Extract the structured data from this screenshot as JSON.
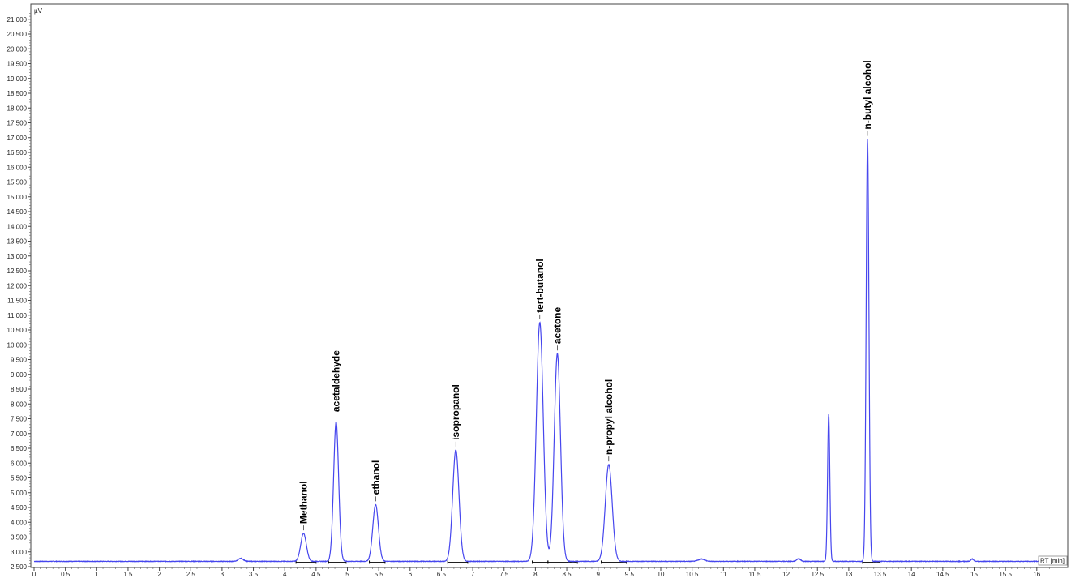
{
  "chart_data": {
    "type": "line",
    "title": "",
    "xlabel": "RT [min]",
    "ylabel": "µV",
    "xlim": [
      0,
      16.25
    ],
    "ylim": [
      2500,
      21250
    ],
    "grid": false,
    "legend": "none",
    "colors": {
      "trace": "#4646ee",
      "baseline": "#000000",
      "frame": "#444444"
    },
    "x_ticks": [
      "0",
      "0.5",
      "1",
      "1.5",
      "2",
      "2.5",
      "3",
      "3.5",
      "4",
      "4.5",
      "5",
      "5.5",
      "6",
      "6.5",
      "7",
      "7.5",
      "8",
      "8.5",
      "9",
      "9.5",
      "10",
      "10.5",
      "11",
      "11.5",
      "12",
      "12.5",
      "13",
      "13.5",
      "14",
      "14.5",
      "15",
      "15.5",
      "16"
    ],
    "y_ticks": [
      "2,500",
      "3,000",
      "3,500",
      "4,000",
      "4,500",
      "5,000",
      "5,500",
      "6,000",
      "6,500",
      "7,000",
      "7,500",
      "8,000",
      "8,500",
      "9,000",
      "9,500",
      "10,000",
      "10,500",
      "11,000",
      "11,500",
      "12,000",
      "12,500",
      "13,000",
      "13,500",
      "14,000",
      "14,500",
      "15,000",
      "15,500",
      "16,000",
      "16,500",
      "17,000",
      "17,500",
      "18,000",
      "18,500",
      "19,000",
      "19,500",
      "20,000",
      "20,500",
      "21,000"
    ],
    "baseline_value": 2680,
    "series": [
      {
        "peaks": [
          {
            "rt": 3.3,
            "height": 2780,
            "width": 0.04,
            "label": ""
          },
          {
            "rt": 4.3,
            "height": 3620,
            "width": 0.045,
            "label": "Methanol"
          },
          {
            "rt": 4.82,
            "height": 7400,
            "width": 0.04,
            "label": "acetaldehyde"
          },
          {
            "rt": 5.45,
            "height": 4600,
            "width": 0.045,
            "label": "ethanol"
          },
          {
            "rt": 6.73,
            "height": 6450,
            "width": 0.05,
            "label": "isopropanol"
          },
          {
            "rt": 8.07,
            "height": 10750,
            "width": 0.055,
            "label": "tert-butanol"
          },
          {
            "rt": 8.35,
            "height": 9700,
            "width": 0.05,
            "label": "acetone"
          },
          {
            "rt": 9.17,
            "height": 5950,
            "width": 0.055,
            "label": "n-propyl alcohol"
          },
          {
            "rt": 10.65,
            "height": 2760,
            "width": 0.05,
            "label": ""
          },
          {
            "rt": 12.2,
            "height": 2770,
            "width": 0.03,
            "label": ""
          },
          {
            "rt": 12.68,
            "height": 7650,
            "width": 0.018,
            "label": ""
          },
          {
            "rt": 13.3,
            "height": 16950,
            "width": 0.022,
            "label": "n-butyl alcohol"
          },
          {
            "rt": 14.97,
            "height": 2760,
            "width": 0.02,
            "label": ""
          }
        ]
      }
    ],
    "integration_baselines": [
      [
        4.18,
        4.5
      ],
      [
        4.7,
        4.98
      ],
      [
        5.35,
        5.6
      ],
      [
        6.6,
        6.92
      ],
      [
        7.95,
        8.2
      ],
      [
        8.2,
        8.67
      ],
      [
        9.05,
        9.45
      ],
      [
        13.22,
        13.5
      ]
    ]
  }
}
